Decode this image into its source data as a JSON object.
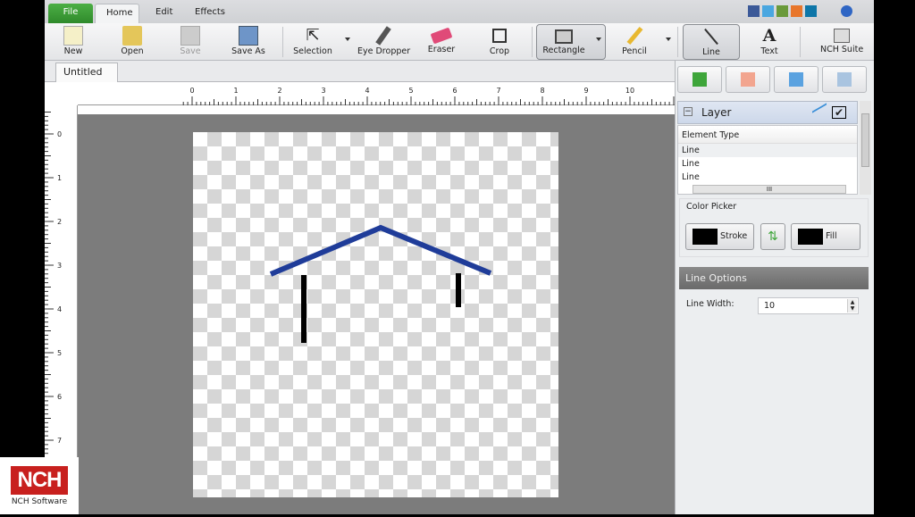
{
  "menu_tabs": [
    "File",
    "Home",
    "Edit",
    "Effects"
  ],
  "toolbar": {
    "new": "New",
    "open": "Open",
    "save": "Save",
    "save_as": "Save As",
    "selection": "Selection",
    "eye_dropper": "Eye Dropper",
    "eraser": "Eraser",
    "crop": "Crop",
    "rectangle": "Rectangle",
    "pencil": "Pencil",
    "line": "Line",
    "text": "Text",
    "nch_suite": "NCH Suite"
  },
  "document_tab": {
    "title": "Untitled",
    "close": "×"
  },
  "ruler": {
    "top": [
      "0",
      "1",
      "2",
      "3",
      "4",
      "5",
      "6",
      "7",
      "8",
      "9",
      "10"
    ],
    "left": [
      "0",
      "1",
      "2",
      "3",
      "4",
      "5",
      "6",
      "7"
    ]
  },
  "layer_panel": {
    "title": "Layer",
    "column": "Element Type",
    "items": [
      "Line",
      "Line",
      "Line"
    ],
    "scroll_mark": "III"
  },
  "color_picker": {
    "title": "Color Picker",
    "stroke": "Stroke",
    "fill": "Fill",
    "stroke_color": "#000000",
    "fill_color": "#000000"
  },
  "line_options": {
    "title": "Line Options",
    "width_label": "Line Width:",
    "width_value": "10"
  },
  "drawing": {
    "roof_color": "#1f3c99",
    "wall_color": "#000000"
  },
  "logo": {
    "mark": "NCH",
    "text": "NCH Software"
  }
}
